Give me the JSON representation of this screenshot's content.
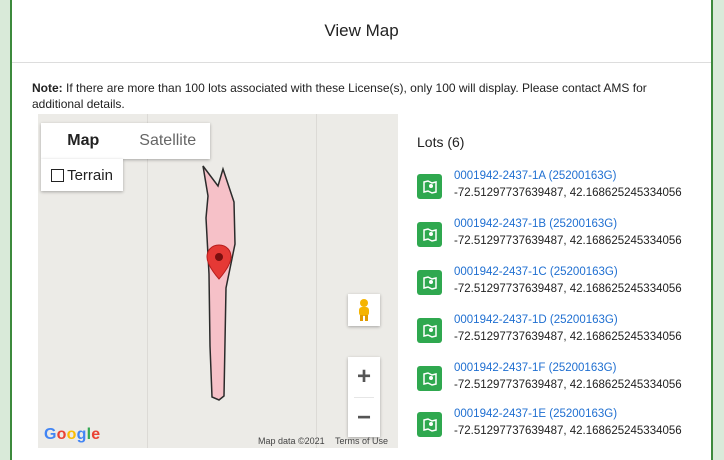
{
  "dialog": {
    "title": "View Map"
  },
  "note": {
    "label": "Note:",
    "text": " If there are more than 100 lots associated with these License(s), only 100 will display. Please contact AMS for additional details."
  },
  "map": {
    "tabs": [
      "Map",
      "Satellite"
    ],
    "terrain_label": "Terrain",
    "zoom_in": "+",
    "zoom_out": "−",
    "logo": "Google",
    "attribution": "Map data ©2021",
    "terms": "Terms of Use"
  },
  "lots": {
    "title": "Lots (6)",
    "items": [
      {
        "name": "0001942-2437-1A (25200163G)",
        "coords": "-72.51297737639487, 42.168625245334056"
      },
      {
        "name": "0001942-2437-1B (25200163G)",
        "coords": "-72.51297737639487, 42.168625245334056"
      },
      {
        "name": "0001942-2437-1C (25200163G)",
        "coords": "-72.51297737639487, 42.168625245334056"
      },
      {
        "name": "0001942-2437-1D (25200163G)",
        "coords": "-72.51297737639487, 42.168625245334056"
      },
      {
        "name": "0001942-2437-1F (25200163G)",
        "coords": "-72.51297737639487, 42.168625245334056"
      },
      {
        "name": "0001942-2437-1E (25200163G)",
        "coords": "-72.51297737639487, 42.168625245334056"
      }
    ]
  },
  "colors": {
    "accent": "#2fa84f",
    "link": "#1f6fd1",
    "polygon_fill": "#f6c1c8",
    "marker": "#e53935"
  }
}
